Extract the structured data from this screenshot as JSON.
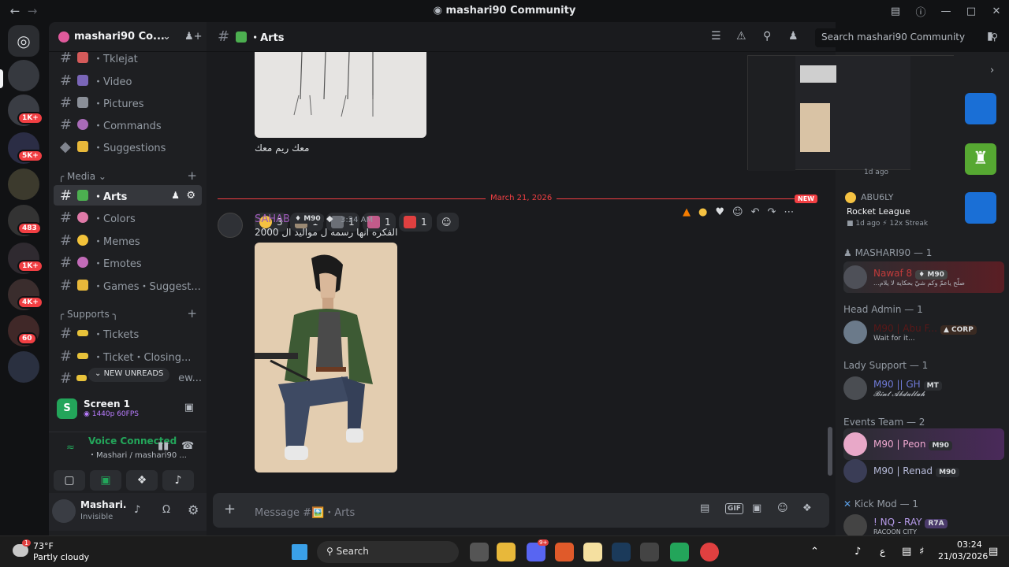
{
  "window": {
    "title": "mashari90 Community"
  },
  "guild": {
    "name": "mashari90 Co..."
  },
  "header": {
    "channel": "・Arts",
    "search_placeholder": "Search mashari90 Community"
  },
  "rail_badges": [
    "1K+",
    "5K+",
    "483",
    "1K+",
    "4K+",
    "60"
  ],
  "channels": {
    "top": [
      {
        "label": "・Tklejat"
      },
      {
        "label": "・Video"
      },
      {
        "label": "・Pictures"
      },
      {
        "label": "・Commands"
      },
      {
        "label": "・Suggestions"
      }
    ],
    "media_category": "Media",
    "media": [
      {
        "label": "・Arts"
      },
      {
        "label": "・Colors"
      },
      {
        "label": "・Memes"
      },
      {
        "label": "・Emotes"
      },
      {
        "label": "・Games・Suggest..."
      }
    ],
    "supports_category": "Supports",
    "supports": [
      {
        "label": "・Tickets"
      },
      {
        "label": "・Ticket・Closing..."
      },
      {
        "label": "ew..."
      }
    ],
    "new_unreads": "NEW UNREADS"
  },
  "screenshare": {
    "title": "Screen 1",
    "quality": "1440p 60FPS"
  },
  "voice": {
    "status": "Voice Connected",
    "channel": "・Mashari / mashari90 ..."
  },
  "user": {
    "name": "Mashari.",
    "status": "Invisible"
  },
  "messages": {
    "prev_caption": "معك ريم معك",
    "reactions": [
      {
        "count": "3",
        "color": "#f5c242"
      },
      {
        "count": "1",
        "color": "#9b8a74"
      },
      {
        "count": "1",
        "color": "#6b6f76"
      },
      {
        "count": "1",
        "color": "#c25b8a"
      },
      {
        "count": "1",
        "color": "#e04040"
      }
    ],
    "divider_date": "March 21, 2026",
    "new_label": "NEW",
    "author": "SAHAB",
    "author_tag": "M90",
    "time": "3:24 AM",
    "text": "الفكره انها رسمه ل مواليد ال 2000"
  },
  "composer": {
    "placeholder": "Message #🖼️・Arts"
  },
  "members": {
    "activity1": {
      "time": "1d ago"
    },
    "activity2": {
      "name": "ABU6LY",
      "game": "Rocket League",
      "time": "1d ago",
      "streak": "12x Streak"
    },
    "roles": [
      {
        "title": "MASHARI90 — 1",
        "members": [
          {
            "name": "Nawaf 8",
            "tag": "M90",
            "sub": "...صلّح ياعمّ وكم شيّ بحكاية لا يلام"
          }
        ]
      },
      {
        "title": "Head Admin — 1",
        "members": [
          {
            "name": "M90 | Abu F...",
            "tag": "CORP",
            "sub": "Wait for it..."
          }
        ]
      },
      {
        "title": "Lady Support — 1",
        "members": [
          {
            "name": "M90 || GH",
            "tag": "MT",
            "sub": "𝓑𝓲𝓷𝓽 𝓐𝓫𝓭𝓾𝓵𝓵𝓪𝓱"
          }
        ]
      },
      {
        "title": "Events Team — 2",
        "members": [
          {
            "name": "M90 | Peon",
            "tag": "M90",
            "sub": ""
          },
          {
            "name": "M90 | Renad",
            "tag": "M90",
            "sub": ""
          }
        ]
      },
      {
        "title": "Kick Mod — 1",
        "members": [
          {
            "name": "! NQ - RAY",
            "tag": "R7A",
            "sub": "RACOON CITY"
          }
        ]
      }
    ]
  },
  "taskbar": {
    "weather_temp": "73°F",
    "weather_desc": "Partly cloudy",
    "weather_badge": "1",
    "search": "Search",
    "lang": "ع",
    "time": "03:24",
    "date": "21/03/2026",
    "discord_badge": "9+"
  },
  "colors": {
    "accent": "#5865f2",
    "green": "#23a55a",
    "red": "#f23f43",
    "author": "#9b59b6"
  }
}
